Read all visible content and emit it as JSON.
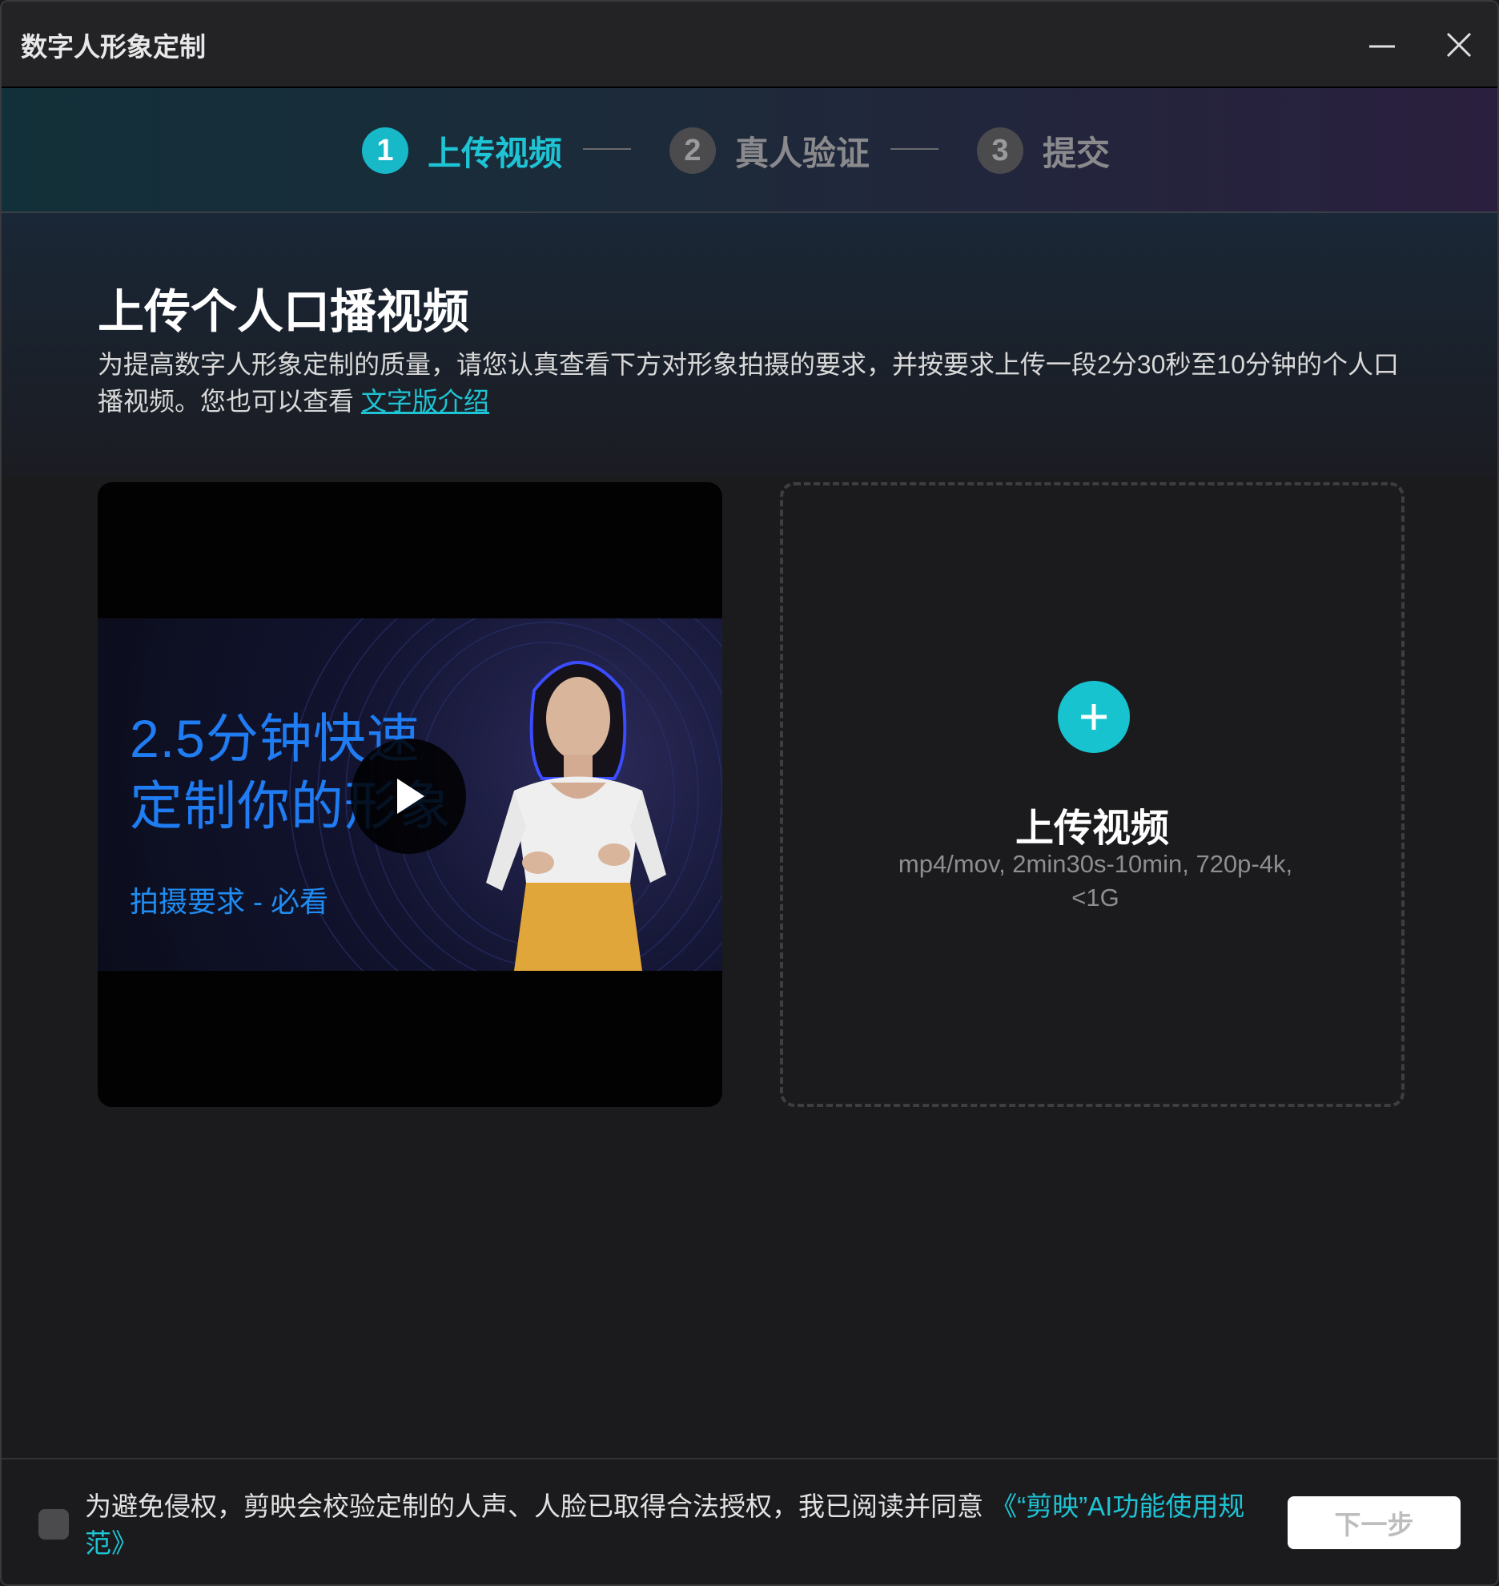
{
  "window": {
    "title": "数字人形象定制"
  },
  "steps": [
    {
      "number": "1",
      "label": "上传视频",
      "state": "active"
    },
    {
      "number": "2",
      "label": "真人验证",
      "state": "inactive"
    },
    {
      "number": "3",
      "label": "提交",
      "state": "inactive"
    }
  ],
  "main": {
    "title": "上传个人口播视频",
    "description": "为提高数字人形象定制的质量，请您认真查看下方对形象拍摄的要求，并按要求上传一段2分30秒至10分钟的个人口播视频。您也可以查看 ",
    "description_link": "文字版介绍"
  },
  "tutorial_video": {
    "headline_line1": "2.5分钟快速",
    "headline_line2": "定制你的形象",
    "subtitle": "拍摄要求 - 必看"
  },
  "upload": {
    "title": "上传视频",
    "hint": "mp4/mov, 2min30s-10min, 720p-4k, <1G"
  },
  "footer": {
    "agreement_text": "为避免侵权，剪映会校验定制的人声、人脸已取得合法授权，我已阅读并同意",
    "agreement_link": "《“剪映”AI功能使用规范》",
    "next_button": "下一步",
    "checkbox_checked": false
  },
  "colors": {
    "accent": "#17c3cf",
    "background": "#1b1b1d",
    "video_text": "#1f7cf2"
  }
}
